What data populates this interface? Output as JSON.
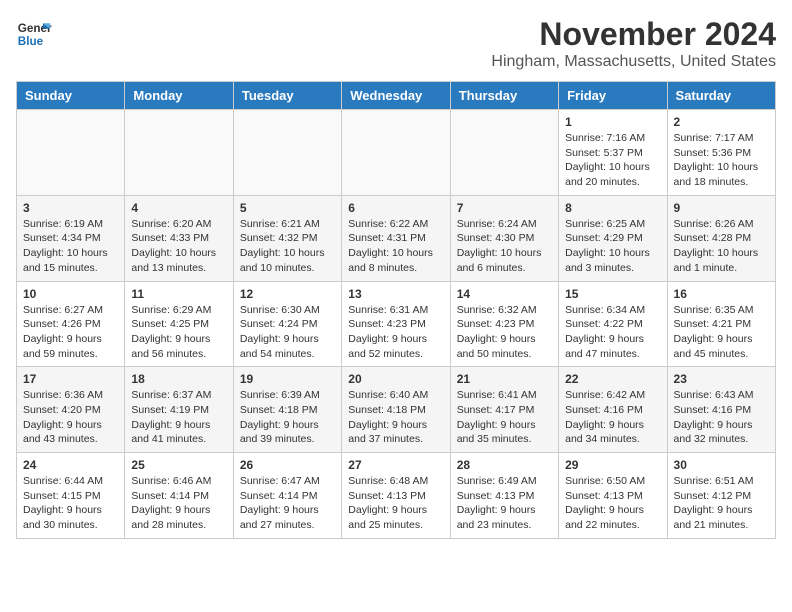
{
  "logo": {
    "line1": "General",
    "line2": "Blue"
  },
  "title": "November 2024",
  "location": "Hingham, Massachusetts, United States",
  "days_of_week": [
    "Sunday",
    "Monday",
    "Tuesday",
    "Wednesday",
    "Thursday",
    "Friday",
    "Saturday"
  ],
  "weeks": [
    [
      {
        "day": "",
        "info": ""
      },
      {
        "day": "",
        "info": ""
      },
      {
        "day": "",
        "info": ""
      },
      {
        "day": "",
        "info": ""
      },
      {
        "day": "",
        "info": ""
      },
      {
        "day": "1",
        "info": "Sunrise: 7:16 AM\nSunset: 5:37 PM\nDaylight: 10 hours and 20 minutes."
      },
      {
        "day": "2",
        "info": "Sunrise: 7:17 AM\nSunset: 5:36 PM\nDaylight: 10 hours and 18 minutes."
      }
    ],
    [
      {
        "day": "3",
        "info": "Sunrise: 6:19 AM\nSunset: 4:34 PM\nDaylight: 10 hours and 15 minutes."
      },
      {
        "day": "4",
        "info": "Sunrise: 6:20 AM\nSunset: 4:33 PM\nDaylight: 10 hours and 13 minutes."
      },
      {
        "day": "5",
        "info": "Sunrise: 6:21 AM\nSunset: 4:32 PM\nDaylight: 10 hours and 10 minutes."
      },
      {
        "day": "6",
        "info": "Sunrise: 6:22 AM\nSunset: 4:31 PM\nDaylight: 10 hours and 8 minutes."
      },
      {
        "day": "7",
        "info": "Sunrise: 6:24 AM\nSunset: 4:30 PM\nDaylight: 10 hours and 6 minutes."
      },
      {
        "day": "8",
        "info": "Sunrise: 6:25 AM\nSunset: 4:29 PM\nDaylight: 10 hours and 3 minutes."
      },
      {
        "day": "9",
        "info": "Sunrise: 6:26 AM\nSunset: 4:28 PM\nDaylight: 10 hours and 1 minute."
      }
    ],
    [
      {
        "day": "10",
        "info": "Sunrise: 6:27 AM\nSunset: 4:26 PM\nDaylight: 9 hours and 59 minutes."
      },
      {
        "day": "11",
        "info": "Sunrise: 6:29 AM\nSunset: 4:25 PM\nDaylight: 9 hours and 56 minutes."
      },
      {
        "day": "12",
        "info": "Sunrise: 6:30 AM\nSunset: 4:24 PM\nDaylight: 9 hours and 54 minutes."
      },
      {
        "day": "13",
        "info": "Sunrise: 6:31 AM\nSunset: 4:23 PM\nDaylight: 9 hours and 52 minutes."
      },
      {
        "day": "14",
        "info": "Sunrise: 6:32 AM\nSunset: 4:23 PM\nDaylight: 9 hours and 50 minutes."
      },
      {
        "day": "15",
        "info": "Sunrise: 6:34 AM\nSunset: 4:22 PM\nDaylight: 9 hours and 47 minutes."
      },
      {
        "day": "16",
        "info": "Sunrise: 6:35 AM\nSunset: 4:21 PM\nDaylight: 9 hours and 45 minutes."
      }
    ],
    [
      {
        "day": "17",
        "info": "Sunrise: 6:36 AM\nSunset: 4:20 PM\nDaylight: 9 hours and 43 minutes."
      },
      {
        "day": "18",
        "info": "Sunrise: 6:37 AM\nSunset: 4:19 PM\nDaylight: 9 hours and 41 minutes."
      },
      {
        "day": "19",
        "info": "Sunrise: 6:39 AM\nSunset: 4:18 PM\nDaylight: 9 hours and 39 minutes."
      },
      {
        "day": "20",
        "info": "Sunrise: 6:40 AM\nSunset: 4:18 PM\nDaylight: 9 hours and 37 minutes."
      },
      {
        "day": "21",
        "info": "Sunrise: 6:41 AM\nSunset: 4:17 PM\nDaylight: 9 hours and 35 minutes."
      },
      {
        "day": "22",
        "info": "Sunrise: 6:42 AM\nSunset: 4:16 PM\nDaylight: 9 hours and 34 minutes."
      },
      {
        "day": "23",
        "info": "Sunrise: 6:43 AM\nSunset: 4:16 PM\nDaylight: 9 hours and 32 minutes."
      }
    ],
    [
      {
        "day": "24",
        "info": "Sunrise: 6:44 AM\nSunset: 4:15 PM\nDaylight: 9 hours and 30 minutes."
      },
      {
        "day": "25",
        "info": "Sunrise: 6:46 AM\nSunset: 4:14 PM\nDaylight: 9 hours and 28 minutes."
      },
      {
        "day": "26",
        "info": "Sunrise: 6:47 AM\nSunset: 4:14 PM\nDaylight: 9 hours and 27 minutes."
      },
      {
        "day": "27",
        "info": "Sunrise: 6:48 AM\nSunset: 4:13 PM\nDaylight: 9 hours and 25 minutes."
      },
      {
        "day": "28",
        "info": "Sunrise: 6:49 AM\nSunset: 4:13 PM\nDaylight: 9 hours and 23 minutes."
      },
      {
        "day": "29",
        "info": "Sunrise: 6:50 AM\nSunset: 4:13 PM\nDaylight: 9 hours and 22 minutes."
      },
      {
        "day": "30",
        "info": "Sunrise: 6:51 AM\nSunset: 4:12 PM\nDaylight: 9 hours and 21 minutes."
      }
    ]
  ]
}
